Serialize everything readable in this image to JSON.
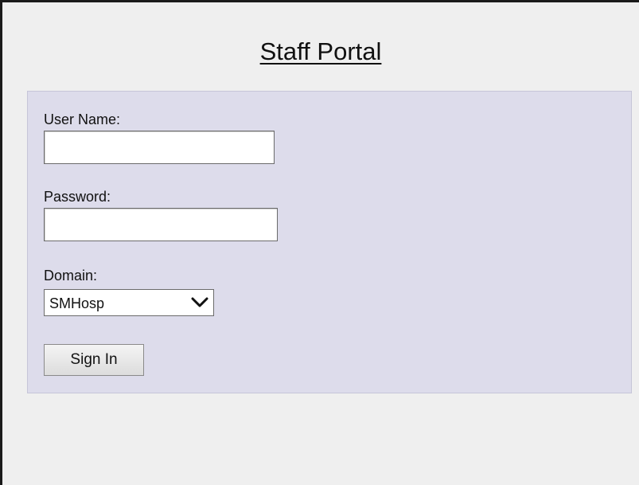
{
  "page": {
    "title": "Staff Portal"
  },
  "login": {
    "username_label": "User Name:",
    "username_value": "",
    "password_label": "Password:",
    "password_value": "",
    "domain_label": "Domain:",
    "domain_selected": "SMHosp",
    "signin_label": "Sign In"
  },
  "icons": {
    "domain_dropdown": "chevron-down-icon"
  },
  "colors": {
    "background": "#efefef",
    "panel": "#dddceb",
    "panel_border": "#c6c5d8",
    "frame": "#1a1a1a"
  }
}
